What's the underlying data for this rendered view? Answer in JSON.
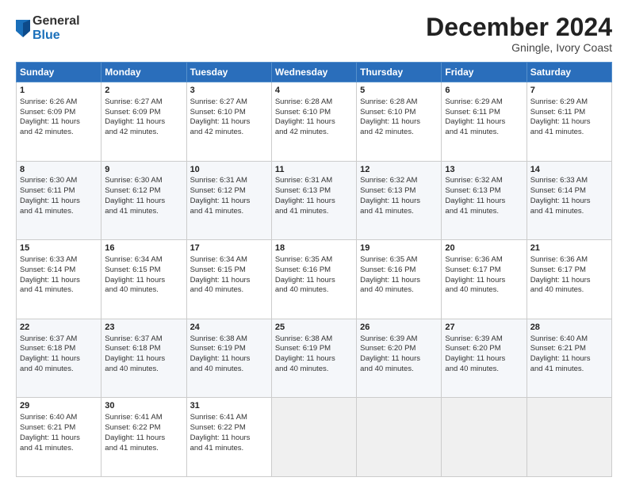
{
  "logo": {
    "general": "General",
    "blue": "Blue"
  },
  "header": {
    "month": "December 2024",
    "location": "Gningle, Ivory Coast"
  },
  "weekdays": [
    "Sunday",
    "Monday",
    "Tuesday",
    "Wednesday",
    "Thursday",
    "Friday",
    "Saturday"
  ],
  "weeks": [
    [
      {
        "day": "1",
        "lines": [
          "Sunrise: 6:26 AM",
          "Sunset: 6:09 PM",
          "Daylight: 11 hours",
          "and 42 minutes."
        ]
      },
      {
        "day": "2",
        "lines": [
          "Sunrise: 6:27 AM",
          "Sunset: 6:09 PM",
          "Daylight: 11 hours",
          "and 42 minutes."
        ]
      },
      {
        "day": "3",
        "lines": [
          "Sunrise: 6:27 AM",
          "Sunset: 6:10 PM",
          "Daylight: 11 hours",
          "and 42 minutes."
        ]
      },
      {
        "day": "4",
        "lines": [
          "Sunrise: 6:28 AM",
          "Sunset: 6:10 PM",
          "Daylight: 11 hours",
          "and 42 minutes."
        ]
      },
      {
        "day": "5",
        "lines": [
          "Sunrise: 6:28 AM",
          "Sunset: 6:10 PM",
          "Daylight: 11 hours",
          "and 42 minutes."
        ]
      },
      {
        "day": "6",
        "lines": [
          "Sunrise: 6:29 AM",
          "Sunset: 6:11 PM",
          "Daylight: 11 hours",
          "and 41 minutes."
        ]
      },
      {
        "day": "7",
        "lines": [
          "Sunrise: 6:29 AM",
          "Sunset: 6:11 PM",
          "Daylight: 11 hours",
          "and 41 minutes."
        ]
      }
    ],
    [
      {
        "day": "8",
        "lines": [
          "Sunrise: 6:30 AM",
          "Sunset: 6:11 PM",
          "Daylight: 11 hours",
          "and 41 minutes."
        ]
      },
      {
        "day": "9",
        "lines": [
          "Sunrise: 6:30 AM",
          "Sunset: 6:12 PM",
          "Daylight: 11 hours",
          "and 41 minutes."
        ]
      },
      {
        "day": "10",
        "lines": [
          "Sunrise: 6:31 AM",
          "Sunset: 6:12 PM",
          "Daylight: 11 hours",
          "and 41 minutes."
        ]
      },
      {
        "day": "11",
        "lines": [
          "Sunrise: 6:31 AM",
          "Sunset: 6:13 PM",
          "Daylight: 11 hours",
          "and 41 minutes."
        ]
      },
      {
        "day": "12",
        "lines": [
          "Sunrise: 6:32 AM",
          "Sunset: 6:13 PM",
          "Daylight: 11 hours",
          "and 41 minutes."
        ]
      },
      {
        "day": "13",
        "lines": [
          "Sunrise: 6:32 AM",
          "Sunset: 6:13 PM",
          "Daylight: 11 hours",
          "and 41 minutes."
        ]
      },
      {
        "day": "14",
        "lines": [
          "Sunrise: 6:33 AM",
          "Sunset: 6:14 PM",
          "Daylight: 11 hours",
          "and 41 minutes."
        ]
      }
    ],
    [
      {
        "day": "15",
        "lines": [
          "Sunrise: 6:33 AM",
          "Sunset: 6:14 PM",
          "Daylight: 11 hours",
          "and 41 minutes."
        ]
      },
      {
        "day": "16",
        "lines": [
          "Sunrise: 6:34 AM",
          "Sunset: 6:15 PM",
          "Daylight: 11 hours",
          "and 40 minutes."
        ]
      },
      {
        "day": "17",
        "lines": [
          "Sunrise: 6:34 AM",
          "Sunset: 6:15 PM",
          "Daylight: 11 hours",
          "and 40 minutes."
        ]
      },
      {
        "day": "18",
        "lines": [
          "Sunrise: 6:35 AM",
          "Sunset: 6:16 PM",
          "Daylight: 11 hours",
          "and 40 minutes."
        ]
      },
      {
        "day": "19",
        "lines": [
          "Sunrise: 6:35 AM",
          "Sunset: 6:16 PM",
          "Daylight: 11 hours",
          "and 40 minutes."
        ]
      },
      {
        "day": "20",
        "lines": [
          "Sunrise: 6:36 AM",
          "Sunset: 6:17 PM",
          "Daylight: 11 hours",
          "and 40 minutes."
        ]
      },
      {
        "day": "21",
        "lines": [
          "Sunrise: 6:36 AM",
          "Sunset: 6:17 PM",
          "Daylight: 11 hours",
          "and 40 minutes."
        ]
      }
    ],
    [
      {
        "day": "22",
        "lines": [
          "Sunrise: 6:37 AM",
          "Sunset: 6:18 PM",
          "Daylight: 11 hours",
          "and 40 minutes."
        ]
      },
      {
        "day": "23",
        "lines": [
          "Sunrise: 6:37 AM",
          "Sunset: 6:18 PM",
          "Daylight: 11 hours",
          "and 40 minutes."
        ]
      },
      {
        "day": "24",
        "lines": [
          "Sunrise: 6:38 AM",
          "Sunset: 6:19 PM",
          "Daylight: 11 hours",
          "and 40 minutes."
        ]
      },
      {
        "day": "25",
        "lines": [
          "Sunrise: 6:38 AM",
          "Sunset: 6:19 PM",
          "Daylight: 11 hours",
          "and 40 minutes."
        ]
      },
      {
        "day": "26",
        "lines": [
          "Sunrise: 6:39 AM",
          "Sunset: 6:20 PM",
          "Daylight: 11 hours",
          "and 40 minutes."
        ]
      },
      {
        "day": "27",
        "lines": [
          "Sunrise: 6:39 AM",
          "Sunset: 6:20 PM",
          "Daylight: 11 hours",
          "and 40 minutes."
        ]
      },
      {
        "day": "28",
        "lines": [
          "Sunrise: 6:40 AM",
          "Sunset: 6:21 PM",
          "Daylight: 11 hours",
          "and 41 minutes."
        ]
      }
    ],
    [
      {
        "day": "29",
        "lines": [
          "Sunrise: 6:40 AM",
          "Sunset: 6:21 PM",
          "Daylight: 11 hours",
          "and 41 minutes."
        ]
      },
      {
        "day": "30",
        "lines": [
          "Sunrise: 6:41 AM",
          "Sunset: 6:22 PM",
          "Daylight: 11 hours",
          "and 41 minutes."
        ]
      },
      {
        "day": "31",
        "lines": [
          "Sunrise: 6:41 AM",
          "Sunset: 6:22 PM",
          "Daylight: 11 hours",
          "and 41 minutes."
        ]
      },
      null,
      null,
      null,
      null
    ]
  ]
}
